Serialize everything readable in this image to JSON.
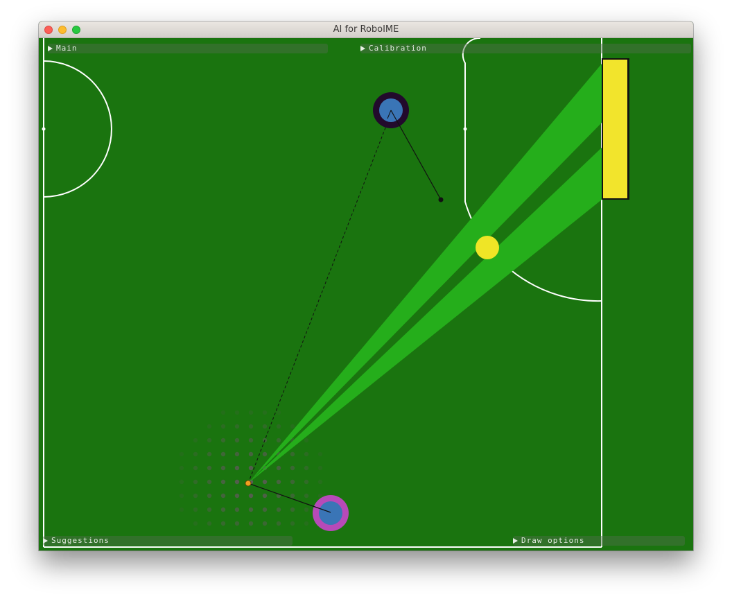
{
  "window": {
    "title": "AI for RoboIME",
    "buttons": [
      "close",
      "minimize",
      "zoom"
    ]
  },
  "panels": {
    "main": "Main",
    "calibration": "Calibration",
    "suggestions": "Suggestions",
    "draw_options": "Draw options"
  },
  "colors": {
    "field": "#1a740f",
    "field_lines": "#ffffff",
    "goal": "#f2e42c",
    "shot_cone": "#25ae1b",
    "ball": "#efe526",
    "robot_fill": "#3a75b6",
    "robot_ring_opponent": "#220a2c",
    "robot_ring_own": "#b74ab8",
    "kick_point": "#f0a020"
  },
  "icons": [
    "disclosure-triangle-icon"
  ]
}
